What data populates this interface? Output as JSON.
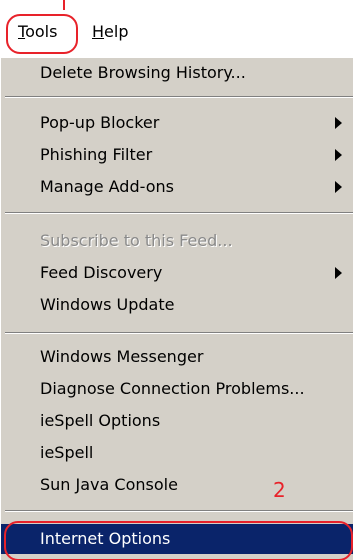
{
  "menubar": {
    "tools": {
      "mnemonic": "T",
      "rest": "ools"
    },
    "help": {
      "mnemonic": "H",
      "rest": "elp"
    }
  },
  "menu": {
    "delete_history": "Delete Browsing History...",
    "popup_blocker": "Pop-up Blocker",
    "phishing_filter": "Phishing Filter",
    "manage_addons": "Manage Add-ons",
    "subscribe_feed": "Subscribe to this Feed...",
    "feed_discovery": "Feed Discovery",
    "windows_update": "Windows Update",
    "windows_messenger": "Windows Messenger",
    "diagnose_connection": "Diagnose Connection Problems...",
    "iespell_options": "ieSpell Options",
    "iespell": "ieSpell",
    "sun_java_console": "Sun Java Console",
    "internet_options": "Internet Options"
  },
  "annotations": {
    "step_number": "2"
  },
  "colors": {
    "menu_background": "#d4d0c8",
    "highlight": "#0a246a",
    "annotation": "#e8222a",
    "disabled_text": "#8a8a8a"
  }
}
